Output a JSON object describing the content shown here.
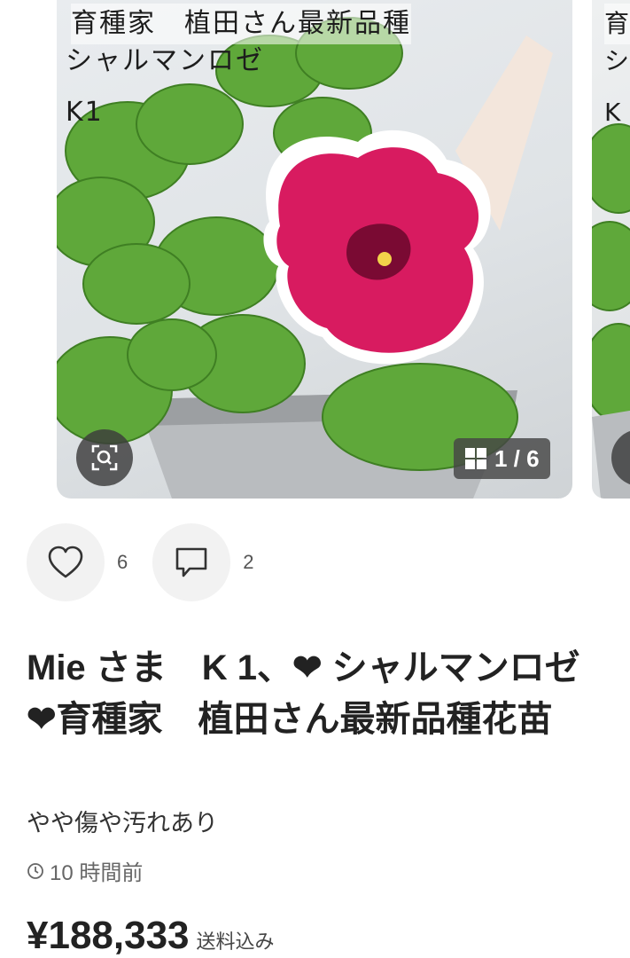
{
  "carousel": {
    "main_photo_text": {
      "line1": "育種家　植田さん最新品種",
      "line2": "シャルマンロゼ",
      "line3": "K1"
    },
    "next_photo_text": {
      "line1": "育",
      "line2": "シ",
      "line3": "K"
    },
    "counter": "1 / 6",
    "zoom_icon": "zoom-scan-icon",
    "grid_icon": "grid-icon"
  },
  "actions": {
    "like_count": "6",
    "comment_count": "2",
    "like_icon": "heart-outline-icon",
    "comment_icon": "comment-icon"
  },
  "item": {
    "title": "Mie さま　K 1、❤︎ シャルマンロゼ ❤︎育種家　植田さん最新品種花苗",
    "condition": "やや傷や汚れあり",
    "posted": "10 時間前",
    "price": "¥188,333",
    "shipping": "送料込み"
  },
  "colors": {
    "flower_magenta": "#d81b60",
    "leaf_green": "#5fa83a",
    "overlay_dark": "#464646"
  }
}
